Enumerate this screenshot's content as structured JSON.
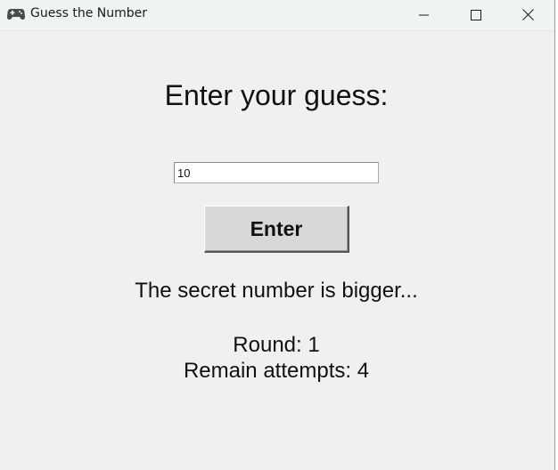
{
  "window": {
    "title": "Guess the Number",
    "app_icon": "gamepad-icon",
    "controls": [
      "minimize-icon",
      "maximize-icon",
      "close-icon"
    ]
  },
  "main": {
    "heading": "Enter your guess:",
    "guess_input_value": "10",
    "enter_button_label": "Enter",
    "feedback": "The secret number is bigger...",
    "round_text": "Round: 1",
    "attempts_text": "Remain attempts: 4"
  }
}
